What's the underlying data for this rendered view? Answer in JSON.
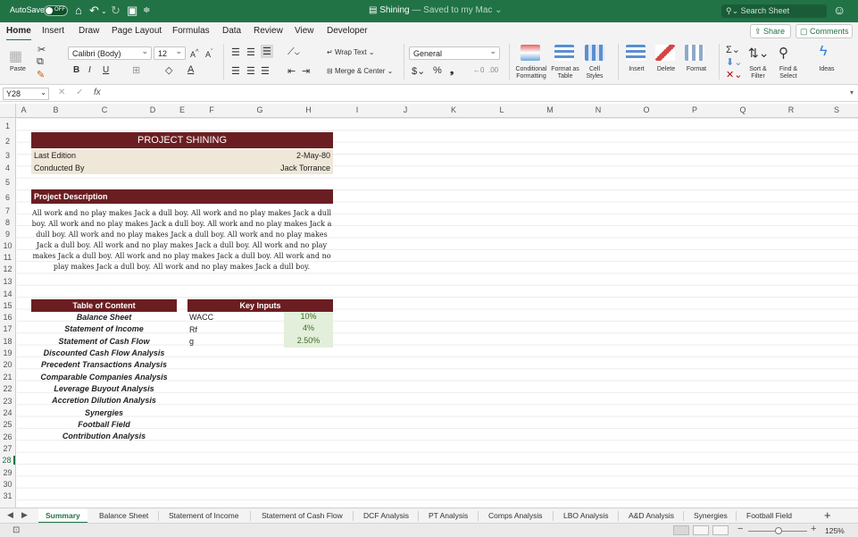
{
  "titlebar": {
    "autosave_label": "AutoSave",
    "autosave_state": "OFF",
    "doc_name": "Shining",
    "save_status": "— Saved to my Mac ⌄",
    "search_placeholder": "Search Sheet"
  },
  "ribbon_tabs": [
    "Home",
    "Insert",
    "Draw",
    "Page Layout",
    "Formulas",
    "Data",
    "Review",
    "View",
    "Developer"
  ],
  "share_label": "Share",
  "comments_label": "Comments",
  "ribbon": {
    "paste_label": "Paste",
    "font_name": "Calibri (Body)",
    "font_size": "12",
    "wrap_text_label": "Wrap Text",
    "merge_center_label": "Merge & Center",
    "number_format": "General",
    "conditional_formatting": "Conditional Formatting",
    "format_as_table": "Format as Table",
    "cell_styles": "Cell Styles",
    "insert": "Insert",
    "delete": "Delete",
    "format": "Format",
    "sort_filter": "Sort & Filter",
    "find_select": "Find & Select",
    "ideas": "Ideas"
  },
  "formula_bar": {
    "name_box": "Y28",
    "fx": "fx",
    "content": ""
  },
  "columns": [
    "A",
    "B",
    "C",
    "D",
    "E",
    "F",
    "G",
    "H",
    "I",
    "J",
    "K",
    "L",
    "M",
    "N",
    "O",
    "P",
    "Q",
    "R",
    "S"
  ],
  "rows": [
    "1",
    "2",
    "3",
    "4",
    "5",
    "6",
    "7",
    "8",
    "9",
    "10",
    "11",
    "12",
    "13",
    "14",
    "15",
    "16",
    "17",
    "18",
    "19",
    "20",
    "21",
    "22",
    "23",
    "24",
    "25",
    "26",
    "27",
    "28",
    "29",
    "30",
    "31"
  ],
  "sheet": {
    "project_title": "PROJECT SHINING",
    "last_edition_label": "Last Edition",
    "last_edition_value": "2-May-80",
    "conducted_by_label": "Conducted By",
    "conducted_by_value": "Jack Torrance",
    "description_header": "Project Description",
    "description_text": "All work and no play makes Jack a dull boy. All work and no play makes Jack a dull boy. All work and no play makes Jack a dull boy. All work and no play makes Jack a dull boy. All work and no play makes Jack a dull boy. All work and no play makes Jack a dull boy. All work and no play makes Jack a dull boy. All work and no play makes Jack a dull boy. All work and no play makes Jack a dull boy. All work and no play makes Jack a dull boy. All work and no play makes Jack a dull boy.",
    "toc_header": "Table of Content",
    "toc_items": [
      "Balance Sheet",
      "Statement of Income",
      "Statement of Cash Flow",
      "Discounted Cash Flow Analysis",
      "Precedent Transactions Analysis",
      "Comparable Companies Analysis",
      "Leverage Buyout Analysis",
      "Accretion Dilution Analysis",
      "Synergies",
      "Football Field",
      "Contribution Analysis"
    ],
    "key_inputs_header": "Key Inputs",
    "key_inputs": [
      {
        "label": "WACC",
        "value": "10%"
      },
      {
        "label": "Rf",
        "value": "4%"
      },
      {
        "label": "g",
        "value": "2.50%"
      }
    ]
  },
  "sheet_tabs": [
    "Summary",
    "Balance Sheet",
    "Statement of Income",
    "Statement of Cash Flow",
    "DCF Analysis",
    "PT Analysis",
    "Comps Analysis",
    "LBO Analysis",
    "A&D Analysis",
    "Synergies",
    "Football Field"
  ],
  "status": {
    "zoom": "125%"
  },
  "colors": {
    "excel_green": "#217346",
    "banner": "#6b1e22",
    "cream": "#efe7d8",
    "input_fill": "#e3efda"
  }
}
